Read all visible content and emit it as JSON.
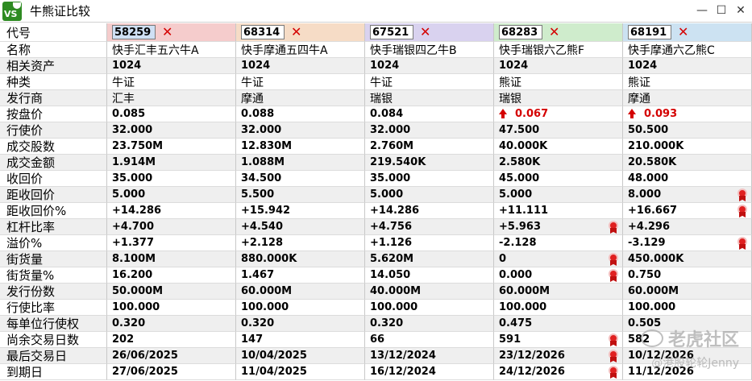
{
  "window": {
    "app_icon_text": "VS",
    "title": "牛熊证比较",
    "minimize": "—",
    "maximize": "☐",
    "close": "✕"
  },
  "header": {
    "label": "代号",
    "columns": [
      {
        "code": "58259",
        "bg": "#f5cccc",
        "selected": true
      },
      {
        "code": "68314",
        "bg": "#f6dcc6",
        "selected": false
      },
      {
        "code": "67521",
        "bg": "#d9d2ef",
        "selected": false
      },
      {
        "code": "68283",
        "bg": "#cfeccc",
        "selected": false
      },
      {
        "code": "68191",
        "bg": "#cce2f2",
        "selected": false
      }
    ],
    "remove_glyph": "✕"
  },
  "rows": [
    {
      "label": "名称",
      "cjk": true,
      "values": [
        "快手汇丰五六牛A",
        "快手摩通五四牛A",
        "快手瑞银四乙牛B",
        "快手瑞银六乙熊F",
        "快手摩通六乙熊C"
      ]
    },
    {
      "label": "相关资产",
      "values": [
        "1024",
        "1024",
        "1024",
        "1024",
        "1024"
      ]
    },
    {
      "label": "种类",
      "cjk": true,
      "values": [
        "牛证",
        "牛证",
        "牛证",
        "熊证",
        "熊证"
      ]
    },
    {
      "label": "发行商",
      "cjk": true,
      "values": [
        "汇丰",
        "摩通",
        "瑞银",
        "瑞银",
        "摩通"
      ]
    },
    {
      "label": "按盘价",
      "values": [
        "0.085",
        "0.088",
        "0.084",
        "0.067",
        "0.093"
      ],
      "up": [
        false,
        false,
        false,
        true,
        true
      ]
    },
    {
      "label": "行使价",
      "values": [
        "32.000",
        "32.000",
        "32.000",
        "47.500",
        "50.500"
      ]
    },
    {
      "label": "成交股数",
      "values": [
        "23.750M",
        "12.830M",
        "2.760M",
        "40.000K",
        "210.000K"
      ]
    },
    {
      "label": "成交金额",
      "values": [
        "1.914M",
        "1.088M",
        "219.540K",
        "2.580K",
        "20.580K"
      ]
    },
    {
      "label": "收回价",
      "values": [
        "35.000",
        "34.500",
        "35.000",
        "45.000",
        "48.000"
      ]
    },
    {
      "label": "距收回价",
      "values": [
        "5.000",
        "5.500",
        "5.000",
        "5.000",
        "8.000"
      ],
      "badge": [
        false,
        false,
        false,
        false,
        true
      ]
    },
    {
      "label": "距收回价%",
      "values": [
        "+14.286",
        "+15.942",
        "+14.286",
        "+11.111",
        "+16.667"
      ],
      "badge": [
        false,
        false,
        false,
        false,
        true
      ]
    },
    {
      "label": "杠杆比率",
      "values": [
        "+4.700",
        "+4.540",
        "+4.756",
        "+5.963",
        "+4.296"
      ],
      "badge": [
        false,
        false,
        false,
        true,
        false
      ]
    },
    {
      "label": "溢价%",
      "values": [
        "+1.377",
        "+2.128",
        "+1.126",
        "-2.128",
        "-3.129"
      ],
      "badge": [
        false,
        false,
        false,
        false,
        true
      ]
    },
    {
      "label": "街货量",
      "values": [
        "8.100M",
        "880.000K",
        "5.620M",
        "0",
        "450.000K"
      ],
      "badge": [
        false,
        false,
        false,
        true,
        false
      ]
    },
    {
      "label": "街货量%",
      "values": [
        "16.200",
        "1.467",
        "14.050",
        "0.000",
        "0.750"
      ],
      "badge": [
        false,
        false,
        false,
        true,
        false
      ]
    },
    {
      "label": "发行份数",
      "values": [
        "50.000M",
        "60.000M",
        "40.000M",
        "60.000M",
        "60.000M"
      ]
    },
    {
      "label": "行使比率",
      "values": [
        "100.000",
        "100.000",
        "100.000",
        "100.000",
        "100.000"
      ]
    },
    {
      "label": "每单位行使权",
      "values": [
        "0.320",
        "0.320",
        "0.320",
        "0.475",
        "0.505"
      ]
    },
    {
      "label": "尚余交易日数",
      "values": [
        "202",
        "147",
        "66",
        "591",
        "582"
      ],
      "badge": [
        false,
        false,
        false,
        true,
        false
      ]
    },
    {
      "label": "最后交易日",
      "values": [
        "26/06/2025",
        "10/04/2025",
        "13/12/2024",
        "23/12/2026",
        "10/12/2026"
      ],
      "badge": [
        false,
        false,
        false,
        true,
        false
      ]
    },
    {
      "label": "到期日",
      "values": [
        "27/06/2025",
        "11/04/2025",
        "16/12/2024",
        "24/12/2026",
        "11/12/2026"
      ],
      "badge": [
        false,
        false,
        false,
        true,
        false
      ]
    }
  ],
  "watermark": {
    "line1": "老虎社区",
    "line2": "@港股轮轮Jenny"
  },
  "colors": {
    "up_red": "#d40000",
    "row_shade": "#efefef",
    "icon_green": "#2e8b22"
  }
}
